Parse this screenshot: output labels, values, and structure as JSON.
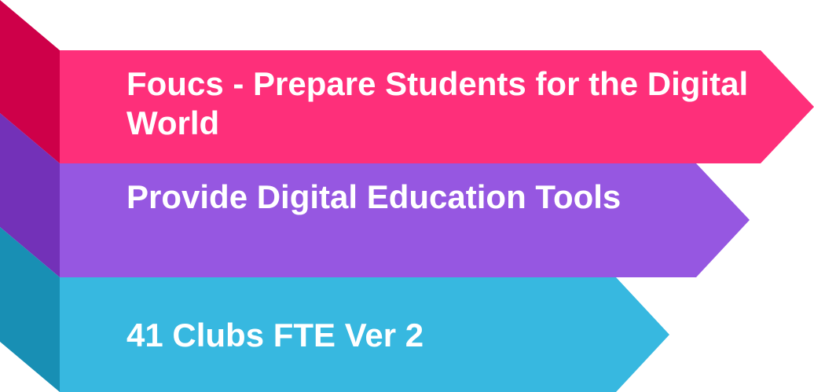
{
  "colors": {
    "pink": "#FE2F7A",
    "pink_side": "#CE0049",
    "purple": "#9657E1",
    "purple_side": "#7331B8",
    "blue": "#37B8E0",
    "blue_side": "#188FB4",
    "text": "#FFFFFF"
  },
  "steps": [
    {
      "label": "Foucs - Prepare Students for the Digital World"
    },
    {
      "label": "Provide Digital Education Tools"
    },
    {
      "label": "41 Clubs FTE Ver 2"
    }
  ]
}
